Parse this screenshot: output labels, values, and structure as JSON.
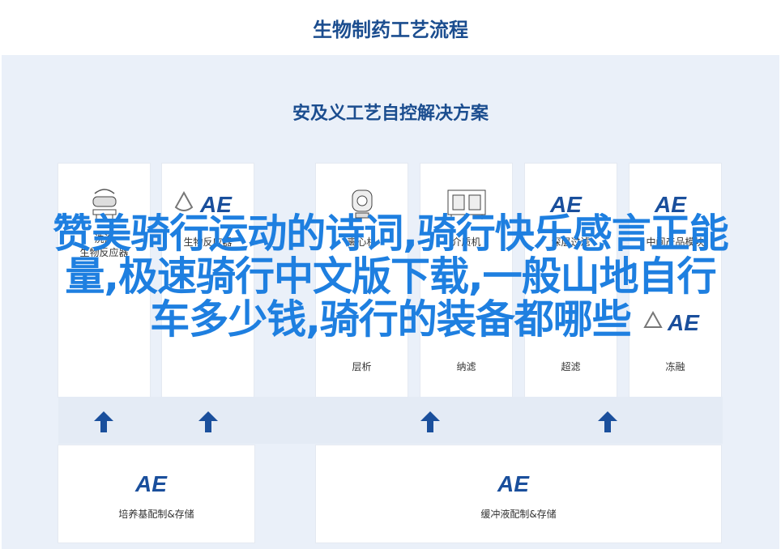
{
  "title": "生物制药工艺流程",
  "subtitle": "安及义工艺自控解决方案",
  "top_cards": [
    {
      "label": "洗涤\n生物反应器",
      "icon": "bioreactor-icon",
      "second_label": ""
    },
    {
      "label": "生物反应器",
      "icon": "ae-logo-icon",
      "second_label": ""
    },
    {
      "label": "离心机",
      "icon": "centrifuge-icon",
      "second_label": "层析"
    },
    {
      "label": "介质机",
      "icon": "machine-icon",
      "second_label": "纳滤"
    },
    {
      "label": "深层过滤",
      "icon": "ae-logo-icon",
      "second_label": "超滤"
    },
    {
      "label": "中间产品模块",
      "icon": "ae-logo-icon",
      "second_label": "冻融"
    }
  ],
  "bottom_cards": [
    {
      "label": "培养基配制&存储",
      "icon": "ae-logo-icon"
    },
    {
      "label": "缓冲液配制&存储",
      "icon": "ae-logo-icon"
    }
  ],
  "brand_mark": "AE",
  "colors": {
    "title": "#1b4d8f",
    "brand": "#1a4f9c",
    "watermark": "#1e7fe0",
    "panel": "#eaf0f9"
  },
  "watermark_lines": [
    "赞美骑行运动的诗词,骑行快乐感言正能",
    "量,极速骑行中文版下载,一般山地自行",
    "车多少钱,骑行的装备都哪些"
  ]
}
